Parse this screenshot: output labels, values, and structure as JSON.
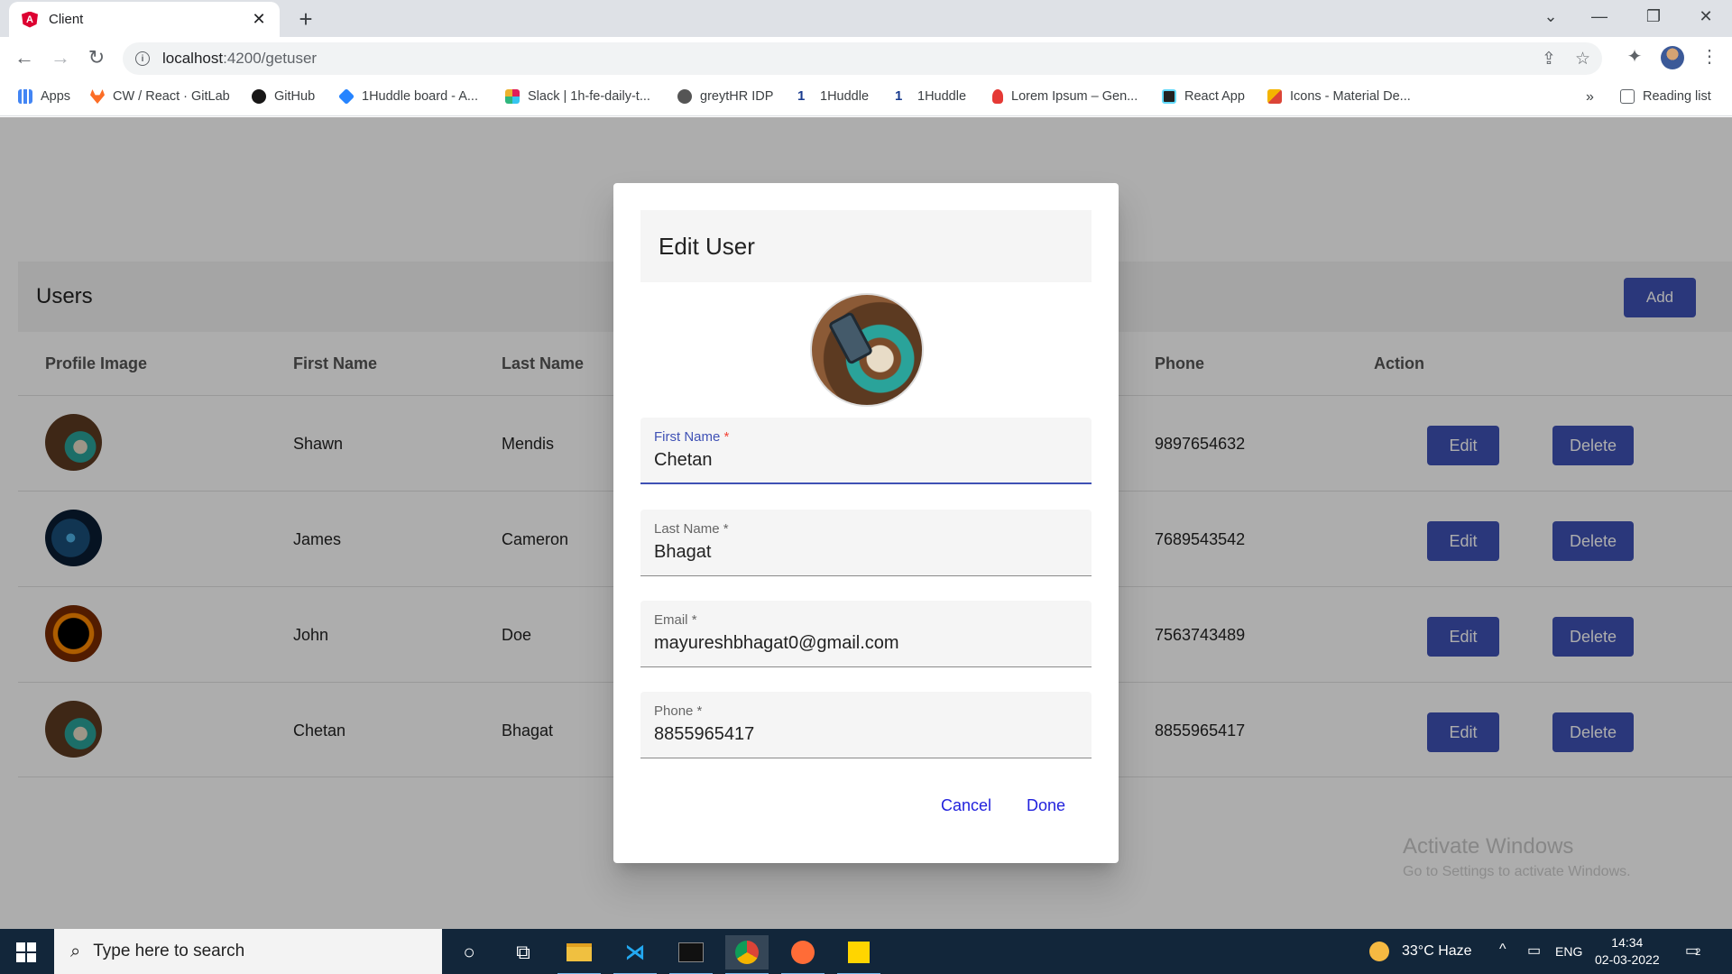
{
  "browser": {
    "tab_title": "Client",
    "tab_close": "✕",
    "new_tab": "+",
    "url_host": "localhost",
    "url_path": ":4200/getuser",
    "reading_list": "Reading list",
    "bookmarks_overflow": "»",
    "bookmarks": [
      {
        "label": "Apps",
        "icon": "apps-grid-icon",
        "color": "#4285f4"
      },
      {
        "label": "CW / React · GitLab",
        "icon": "gitlab-icon",
        "color": "#fc6d26"
      },
      {
        "label": "GitHub",
        "icon": "github-icon",
        "color": "#181717"
      },
      {
        "label": "1Huddle board - A...",
        "icon": "jira-icon",
        "color": "#2684ff"
      },
      {
        "label": "Slack | 1h-fe-daily-t...",
        "icon": "slack-icon",
        "color": "#e01e5a"
      },
      {
        "label": "greytHR IDP",
        "icon": "greythr-icon",
        "color": "#555555"
      },
      {
        "label": "1Huddle",
        "icon": "huddle-icon",
        "color": "#1a3c8f"
      },
      {
        "label": "1Huddle",
        "icon": "huddle-icon",
        "color": "#1a3c8f"
      },
      {
        "label": "Lorem Ipsum – Gen...",
        "icon": "lorem-icon",
        "color": "#e53935"
      },
      {
        "label": "React App",
        "icon": "react-icon",
        "color": "#222222"
      },
      {
        "label": "Icons - Material De...",
        "icon": "material-icon",
        "color": "#f4b400"
      }
    ]
  },
  "page": {
    "card_title": "Users",
    "add_label": "Add",
    "headers": [
      "Profile Image",
      "First Name",
      "Last Name",
      "Phone",
      "Action"
    ],
    "edit_label": "Edit",
    "delete_label": "Delete",
    "rows": [
      {
        "first": "Shawn",
        "last": "Mendis",
        "phone": "9897654632",
        "avatar": "coffee"
      },
      {
        "first": "James",
        "last": "Cameron",
        "phone": "7689543542",
        "avatar": "network"
      },
      {
        "first": "John",
        "last": "Doe",
        "phone": "7563743489",
        "avatar": "eclipse"
      },
      {
        "first": "Chetan",
        "last": "Bhagat",
        "phone": "8855965417",
        "avatar": "coffee"
      }
    ],
    "watermark_title": "Activate Windows",
    "watermark_sub": "Go to Settings to activate Windows."
  },
  "dialog": {
    "title": "Edit User",
    "fields": [
      {
        "label": "First Name",
        "value": "Chetan"
      },
      {
        "label": "Last Name",
        "value": "Bhagat"
      },
      {
        "label": "Email",
        "value": "mayureshbhagat0@gmail.com"
      },
      {
        "label": "Phone",
        "value": "8855965417"
      }
    ],
    "required_mark": "*",
    "cancel_label": "Cancel",
    "done_label": "Done"
  },
  "taskbar": {
    "search_placeholder": "Type here to search",
    "weather": "33°C  Haze",
    "language": "ENG",
    "time": "14:34",
    "date": "02-03-2022",
    "notifications": "2"
  },
  "colors": {
    "primary": "#3f51b5",
    "link": "#2222dd",
    "required": "#f44336"
  }
}
